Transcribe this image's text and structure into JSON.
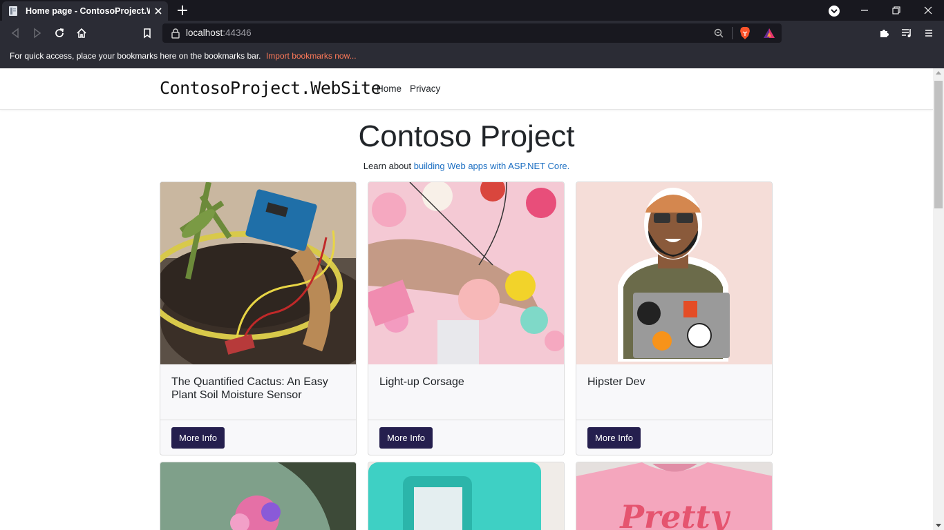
{
  "browser": {
    "tab_title": "Home page - ContosoProject.WebSite",
    "url_host": "localhost",
    "url_port": ":44346",
    "bookmarks_message": "For quick access, place your bookmarks here on the bookmarks bar.",
    "bookmarks_link": "Import bookmarks now..."
  },
  "site": {
    "brand": "ContosoProject.WebSite",
    "nav": [
      "Home",
      "Privacy"
    ],
    "hero_title": "Contoso Project",
    "hero_sub_prefix": "Learn about",
    "hero_sub_link": "building Web apps with ASP.NET Core."
  },
  "cards": [
    {
      "title": "The Quantified Cactus: An Easy Plant Soil Moisture Sensor",
      "button": "More Info",
      "image": "cactus-arduino-photo"
    },
    {
      "title": "Light-up Corsage",
      "button": "More Info",
      "image": "flower-corsage-photo"
    },
    {
      "title": "Hipster Dev",
      "button": "More Info",
      "image": "hipster-dev-illustration"
    }
  ],
  "more_cards": [
    {
      "image": "pink-flower-photo"
    },
    {
      "image": "teal-case-photo"
    },
    {
      "image": "pink-tshirt-photo",
      "text": "Pretty"
    }
  ],
  "colors": {
    "button": "#251f4e",
    "link": "#1b6ec2",
    "import_link": "#ff7a59"
  }
}
